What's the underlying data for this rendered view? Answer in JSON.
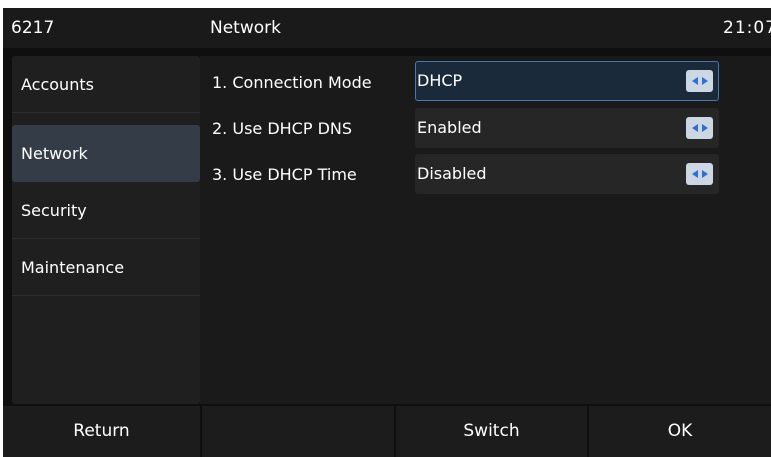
{
  "status_bar": {
    "extension": "6217",
    "title": "Network",
    "time": "21:07"
  },
  "menu": {
    "items": [
      {
        "label": "Accounts"
      },
      {
        "label": "Network"
      },
      {
        "label": "Security"
      },
      {
        "label": "Maintenance"
      }
    ],
    "selected": "Network"
  },
  "settings": {
    "rows": [
      {
        "label": "1. Connection Mode",
        "value": "DHCP"
      },
      {
        "label": "2. Use DHCP DNS",
        "value": "Enabled"
      },
      {
        "label": "3. Use DHCP Time",
        "value": "Disabled"
      }
    ],
    "focused_row": 1
  },
  "softkeys": {
    "return_label": "Return",
    "blank_label": "",
    "switch_label": "Switch",
    "ok_label": "OK"
  },
  "colors": {
    "screen_bg": "#0f0f0f",
    "active_menu": "#343c47",
    "focus_border": "#4a76b0",
    "arrow_button": "#cdd6e3",
    "arrow_glyph": "#2f6fd0"
  },
  "icons": {
    "combo_switch": "left-right-arrows-icon"
  }
}
